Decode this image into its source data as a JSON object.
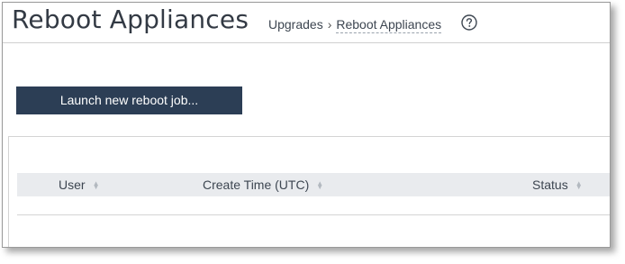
{
  "page": {
    "title": "Reboot Appliances"
  },
  "breadcrumb": {
    "parent": "Upgrades",
    "separator": "›",
    "current": "Reboot Appliances"
  },
  "help": {
    "icon": "question-circle-icon"
  },
  "toolbar": {
    "launch_label": "Launch new reboot job..."
  },
  "table": {
    "columns": [
      {
        "label": "User",
        "sort_icon": "sort-icon"
      },
      {
        "label": "Create Time (UTC)",
        "sort_icon": "sort-icon"
      },
      {
        "label": "Status",
        "sort_icon": "sort-icon"
      }
    ],
    "rows": []
  },
  "colors": {
    "title_text": "#333a44",
    "button_bg": "#2c3e55",
    "table_header_bg": "#e9ebee"
  }
}
